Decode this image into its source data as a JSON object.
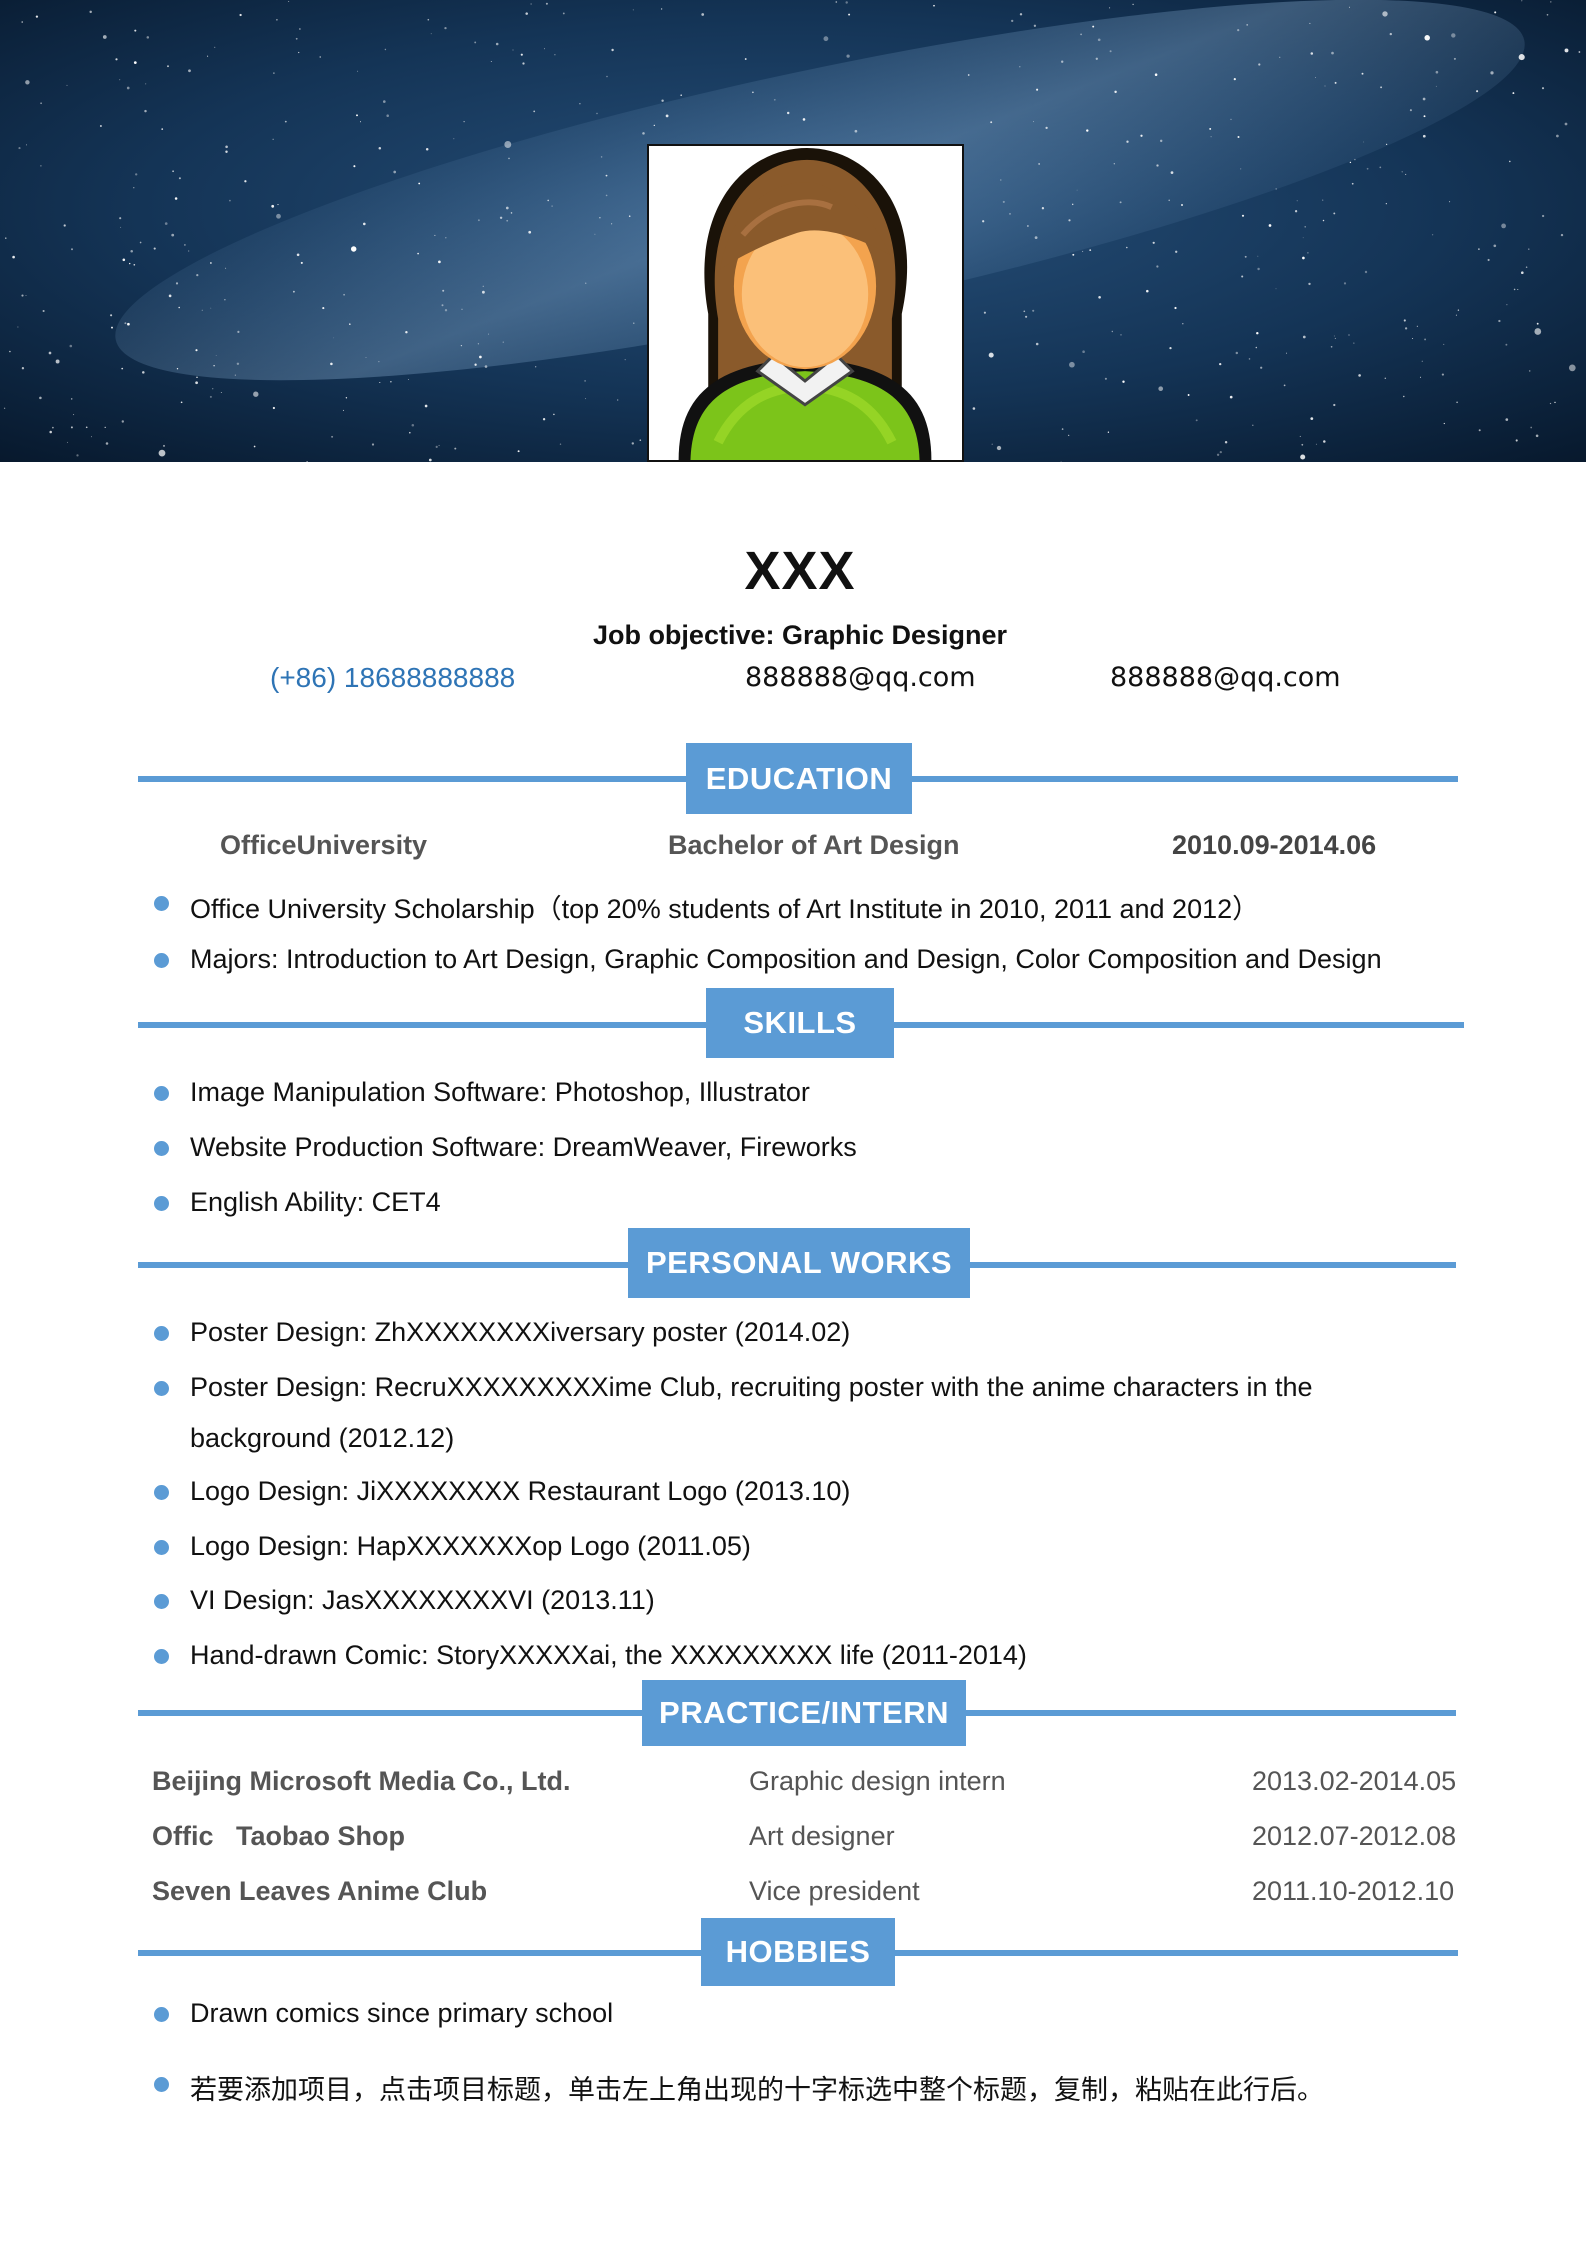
{
  "header": {
    "name": "XXX",
    "objective": "Job objective: Graphic Designer",
    "phone": "(+86) 18688888888",
    "email1": "888888@qq.com",
    "email2": "888888@qq.com"
  },
  "colors": {
    "accent": "#5b9bd5",
    "link": "#2e74b5",
    "banner": "#0f2640"
  },
  "education": {
    "title": "EDUCATION",
    "school": "OfficeUniversity",
    "degree": "Bachelor of Art Design",
    "period": "2010.09-2014.06",
    "items": [
      "Office University Scholarship（top 20% students of Art Institute in 2010, 2011 and 2012）",
      "Majors: Introduction to Art Design, Graphic Composition and Design, Color Composition and Design"
    ]
  },
  "skills": {
    "title": "SKILLS",
    "items": [
      "Image Manipulation Software: Photoshop, Illustrator",
      "Website Production Software: DreamWeaver, Fireworks",
      "English Ability: CET4"
    ]
  },
  "works": {
    "title": "PERSONAL WORKS",
    "items": [
      "Poster Design: ZhXXXXXXXXiversary poster (2014.02)",
      "Poster Design: RecruXXXXXXXXXime Club, recruiting poster with the anime characters in the",
      "background (2012.12)",
      "Logo Design: JiXXXXXXXX Restaurant Logo (2013.10)",
      "Logo Design: HapXXXXXXXop Logo (2011.05)",
      "VI Design: JasXXXXXXXXVI (2013.11)",
      "Hand-drawn Comic: StoryXXXXXai, the XXXXXXXXX life (2011-2014)"
    ]
  },
  "practice": {
    "title": "PRACTICE/INTERN",
    "rows": [
      {
        "company": "Beijing Microsoft Media Co., Ltd.",
        "role": "Graphic design intern",
        "period": "2013.02-2014.05"
      },
      {
        "company": "Offic   Taobao Shop",
        "role": "Art designer",
        "period": "2012.07-2012.08"
      },
      {
        "company": "Seven Leaves Anime Club",
        "role": "Vice president",
        "period": "2011.10-2012.10"
      }
    ]
  },
  "hobbies": {
    "title": "HOBBIES",
    "items": [
      "Drawn comics since primary school",
      "若要添加项目，点击项目标题，单击左上角出现的十字标选中整个标题，复制，粘贴在此行后。"
    ]
  }
}
